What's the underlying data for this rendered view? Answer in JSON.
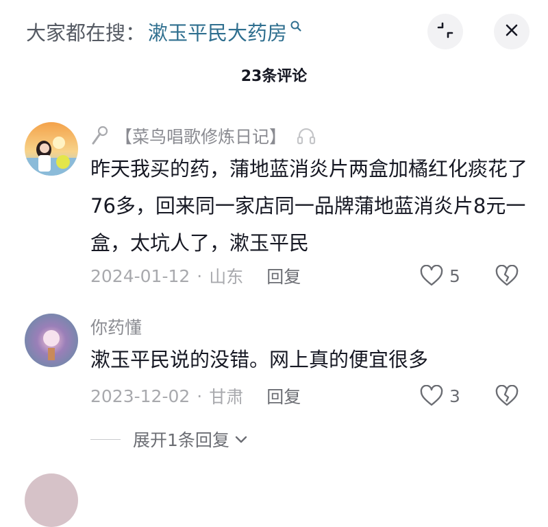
{
  "header": {
    "search_prefix": "大家都在搜：",
    "search_term": "漱玉平民大药房",
    "search_icon": "search-icon",
    "expand_icon": "collapse-icon",
    "close_icon": "close-icon"
  },
  "comments_title": "23条评论",
  "comments": [
    {
      "author": "【菜鸟唱歌修炼日记】",
      "author_icon": "microphone-icon",
      "author_badge_icon": "headphone-icon",
      "text": "昨天我买的药，蒲地蓝消炎片两盒加橘红化痰花了76多，回来同一家店同一品牌蒲地蓝消炎片8元一盒，太坑人了，漱玉平民",
      "date": "2024-01-12",
      "separator": "·",
      "location": "山东",
      "reply_label": "回复",
      "likes": "5"
    },
    {
      "author": "你药懂",
      "text": "漱玉平民说的没错。网上真的便宜很多",
      "date": "2023-12-02",
      "separator": "·",
      "location": "甘肃",
      "reply_label": "回复",
      "likes": "3",
      "expand_label": "展开1条回复"
    }
  ],
  "colors": {
    "link": "#2f6f8f",
    "muted": "#a8a9ad",
    "text": "#161823",
    "button_bg": "#f2f2f4"
  }
}
